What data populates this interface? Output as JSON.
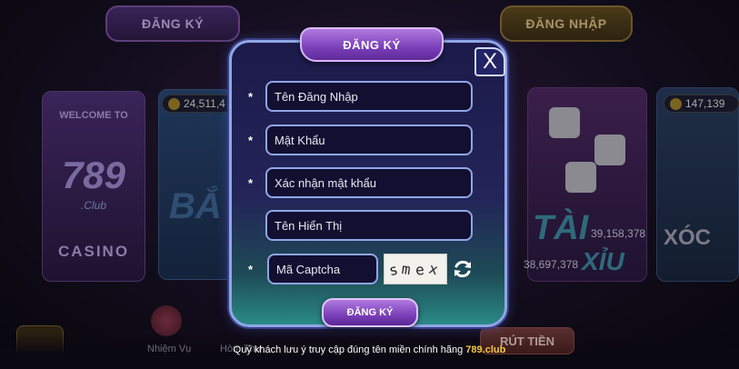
{
  "background": {
    "top_buttons": {
      "register": "ĐĂNG KÝ",
      "login": "ĐĂNG NHẬP"
    },
    "games": {
      "casino": {
        "welcome": "WELCOME TO",
        "logo": "789",
        "club": ".Club",
        "label": "CASINO"
      },
      "fish": {
        "balance": "24,511,4",
        "title": "BẮ"
      },
      "taixiu": {
        "title_top": "TÀI",
        "title_bottom": "XỈU",
        "amount_1": "39,158,378",
        "amount_2": "38,697,378"
      },
      "xocdia": {
        "balance": "147,139",
        "title": "XÓC"
      }
    },
    "bottom_nav": {
      "mission": "Nhiệm Vụ",
      "mailbox": "Hòm Thư",
      "withdraw": "RÚT TIỀN"
    }
  },
  "modal": {
    "title": "ĐĂNG KÝ",
    "close_label": "X",
    "required_mark": "*",
    "fields": {
      "username": {
        "placeholder": "Tên Đăng Nhập"
      },
      "password": {
        "placeholder": "Mật Khẩu"
      },
      "confirm_password": {
        "placeholder": "Xác nhận mật khẩu"
      },
      "display_name": {
        "placeholder": "Tên Hiển Thị"
      },
      "captcha": {
        "placeholder": "Mã Captcha"
      }
    },
    "captcha_chars": [
      "s",
      "m",
      "e",
      "x"
    ],
    "submit_label": "ĐĂNG KÝ"
  },
  "notice": {
    "text": "Quý khách lưu ý truy cập đúng tên miền chính hãng ",
    "domain": "789.club"
  },
  "colors": {
    "modal_border": "#8fa6e6",
    "title_purple": "#7a3fb8",
    "domain_yellow": "#f5c842"
  }
}
